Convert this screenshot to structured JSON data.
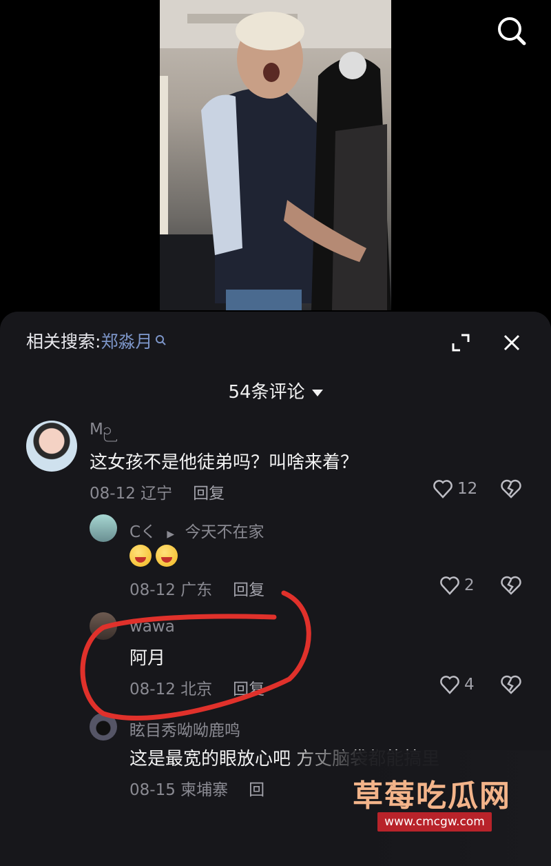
{
  "related_search": {
    "prefix": "相关搜索:",
    "term": "郑淼月"
  },
  "comment_count_label": "54条评论",
  "comments": [
    {
      "username": "Mဉ",
      "text": "这女孩不是他徒弟吗？叫啥来着？",
      "date_location": "08-12 辽宁",
      "reply_label": "回复",
      "likes": "12"
    },
    {
      "username": "Cく",
      "reply_to": "今天不在家",
      "date_location": "08-12 广东",
      "reply_label": "回复",
      "likes": "2"
    },
    {
      "username": "wawa",
      "text": "阿月",
      "date_location": "08-12 北京",
      "reply_label": "回复",
      "likes": "4"
    },
    {
      "username": "眩目秀呦呦鹿鸣",
      "text": "这是最宽的眼放心吧 方丈脑袋都能搞里",
      "date_location": "08-15 柬埔寨",
      "reply_label": "回"
    }
  ],
  "watermark": {
    "title": "草莓吃瓜网",
    "url": "www.cmcgw.com"
  },
  "colors": {
    "sheet_bg": "#17171b",
    "related_term": "#7c95c8",
    "annotation": "#e0312b",
    "watermark_badge": "#b8232a"
  }
}
